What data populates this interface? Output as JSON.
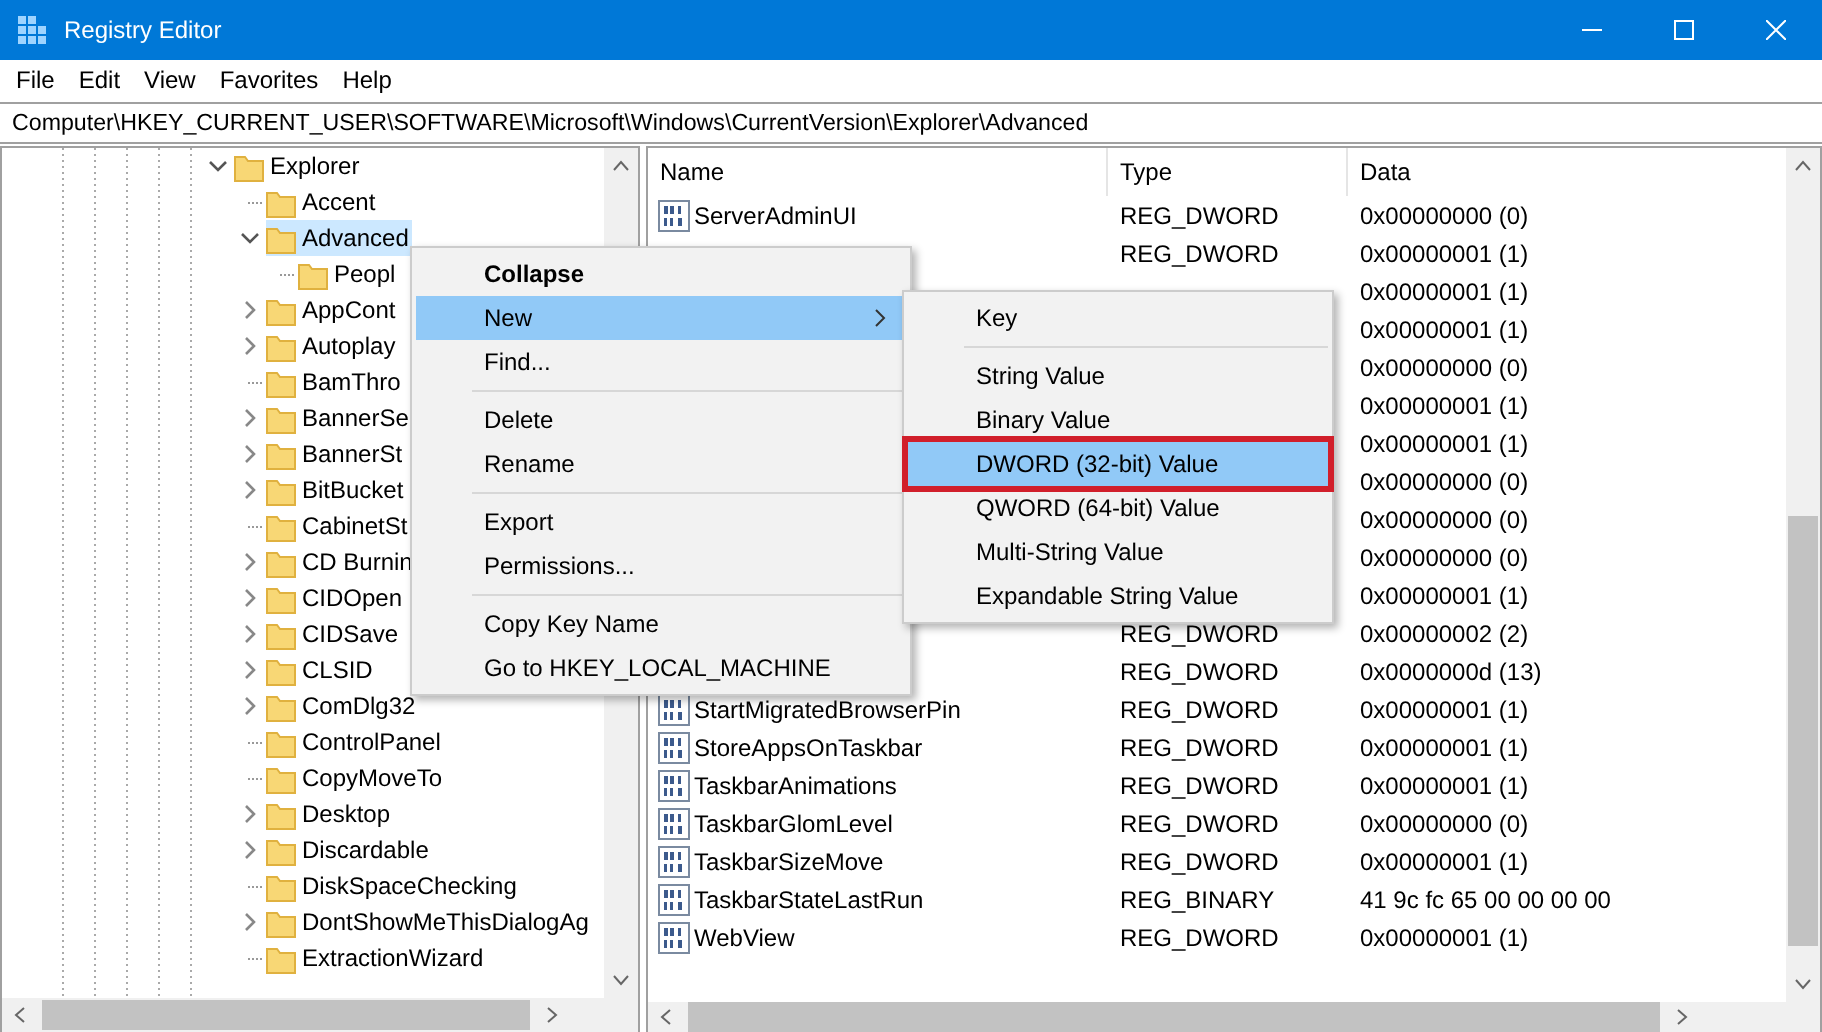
{
  "window": {
    "title": "Registry Editor"
  },
  "menu_bar": [
    "File",
    "Edit",
    "View",
    "Favorites",
    "Help"
  ],
  "address_bar": {
    "value": "Computer\\HKEY_CURRENT_USER\\SOFTWARE\\Microsoft\\Windows\\CurrentVersion\\Explorer\\Advanced"
  },
  "tree": {
    "items": [
      {
        "label": "Explorer",
        "expandable": true,
        "expanded": true,
        "selected": false,
        "children": [
          {
            "label": "Accent",
            "expandable": false,
            "selected": false
          },
          {
            "label": "Advanced",
            "expandable": true,
            "expanded": true,
            "selected": true,
            "children": [
              {
                "label": "Peopl",
                "expandable": false,
                "selected": false
              }
            ]
          },
          {
            "label": "AppCont",
            "expandable": true,
            "expanded": false,
            "selected": false
          },
          {
            "label": "Autoplay",
            "expandable": true,
            "expanded": false,
            "selected": false
          },
          {
            "label": "BamThro",
            "expandable": false,
            "selected": false
          },
          {
            "label": "BannerSe",
            "expandable": true,
            "expanded": false,
            "selected": false
          },
          {
            "label": "BannerSt",
            "expandable": true,
            "expanded": false,
            "selected": false
          },
          {
            "label": "BitBucket",
            "expandable": true,
            "expanded": false,
            "selected": false
          },
          {
            "label": "CabinetSt",
            "expandable": false,
            "selected": false
          },
          {
            "label": "CD Burnin",
            "expandable": true,
            "expanded": false,
            "selected": false
          },
          {
            "label": "CIDOpen",
            "expandable": true,
            "expanded": false,
            "selected": false
          },
          {
            "label": "CIDSave",
            "expandable": true,
            "expanded": false,
            "selected": false
          },
          {
            "label": "CLSID",
            "expandable": true,
            "expanded": false,
            "selected": false
          },
          {
            "label": "ComDlg32",
            "expandable": true,
            "expanded": false,
            "selected": false
          },
          {
            "label": "ControlPanel",
            "expandable": false,
            "selected": false
          },
          {
            "label": "CopyMoveTo",
            "expandable": false,
            "selected": false
          },
          {
            "label": "Desktop",
            "expandable": true,
            "expanded": false,
            "selected": false
          },
          {
            "label": "Discardable",
            "expandable": true,
            "expanded": false,
            "selected": false
          },
          {
            "label": "DiskSpaceChecking",
            "expandable": false,
            "selected": false
          },
          {
            "label": "DontShowMeThisDialogAg",
            "expandable": true,
            "expanded": false,
            "selected": false
          },
          {
            "label": "ExtractionWizard",
            "expandable": false,
            "selected": false
          }
        ]
      }
    ]
  },
  "values": {
    "columns": [
      "Name",
      "Type",
      "Data"
    ],
    "rows": [
      {
        "name": "ServerAdminUI",
        "type": "REG_DWORD",
        "data": "0x00000000 (0)"
      },
      {
        "type": "REG_DWORD",
        "data": "0x00000001 (1)"
      },
      {
        "data": "0x00000001 (1)"
      },
      {
        "data": "0x00000001 (1)"
      },
      {
        "data": "0x00000000 (0)"
      },
      {
        "data": "0x00000001 (1)"
      },
      {
        "data": "0x00000001 (1)"
      },
      {
        "data": "0x00000000 (0)"
      },
      {
        "data": "0x00000000 (0)"
      },
      {
        "data": "0x00000000 (0)"
      },
      {
        "data": "0x00000001 (1)"
      },
      {
        "type": "REG_DWORD",
        "data": "0x00000002 (2)"
      },
      {
        "type": "REG_DWORD",
        "data": "0x0000000d (13)"
      },
      {
        "name": "StartMigratedBrowserPin",
        "type": "REG_DWORD",
        "data": "0x00000001 (1)"
      },
      {
        "name": "StoreAppsOnTaskbar",
        "type": "REG_DWORD",
        "data": "0x00000001 (1)"
      },
      {
        "name": "TaskbarAnimations",
        "type": "REG_DWORD",
        "data": "0x00000001 (1)"
      },
      {
        "name": "TaskbarGlomLevel",
        "type": "REG_DWORD",
        "data": "0x00000000 (0)"
      },
      {
        "name": "TaskbarSizeMove",
        "type": "REG_DWORD",
        "data": "0x00000001 (1)"
      },
      {
        "name": "TaskbarStateLastRun",
        "type": "REG_BINARY",
        "data": "41 9c fc 65 00 00 00 00"
      },
      {
        "name": "WebView",
        "type": "REG_DWORD",
        "data": "0x00000001 (1)"
      }
    ]
  },
  "context_menu": {
    "items": [
      {
        "kind": "item",
        "label": "Collapse",
        "bold": true,
        "selected": false,
        "submenu": false
      },
      {
        "kind": "item",
        "label": "New",
        "bold": false,
        "selected": true,
        "submenu": true
      },
      {
        "kind": "item",
        "label": "Find...",
        "bold": false,
        "selected": false,
        "submenu": false
      },
      {
        "kind": "separator"
      },
      {
        "kind": "item",
        "label": "Delete",
        "bold": false,
        "selected": false,
        "submenu": false
      },
      {
        "kind": "item",
        "label": "Rename",
        "bold": false,
        "selected": false,
        "submenu": false
      },
      {
        "kind": "separator"
      },
      {
        "kind": "item",
        "label": "Export",
        "bold": false,
        "selected": false,
        "submenu": false
      },
      {
        "kind": "item",
        "label": "Permissions...",
        "bold": false,
        "selected": false,
        "submenu": false
      },
      {
        "kind": "separator"
      },
      {
        "kind": "item",
        "label": "Copy Key Name",
        "bold": false,
        "selected": false,
        "submenu": false
      },
      {
        "kind": "item",
        "label": "Go to HKEY_LOCAL_MACHINE",
        "bold": false,
        "selected": false,
        "submenu": false
      }
    ]
  },
  "submenu": {
    "items": [
      {
        "kind": "item",
        "label": "Key",
        "selected": false,
        "outlined": false
      },
      {
        "kind": "separator"
      },
      {
        "kind": "item",
        "label": "String Value",
        "selected": false,
        "outlined": false
      },
      {
        "kind": "item",
        "label": "Binary Value",
        "selected": false,
        "outlined": false
      },
      {
        "kind": "item",
        "label": "DWORD (32-bit) Value",
        "selected": true,
        "outlined": true
      },
      {
        "kind": "item",
        "label": "QWORD (64-bit) Value",
        "selected": false,
        "outlined": false
      },
      {
        "kind": "item",
        "label": "Multi-String Value",
        "selected": false,
        "outlined": false
      },
      {
        "kind": "item",
        "label": "Expandable String Value",
        "selected": false,
        "outlined": false
      }
    ]
  }
}
